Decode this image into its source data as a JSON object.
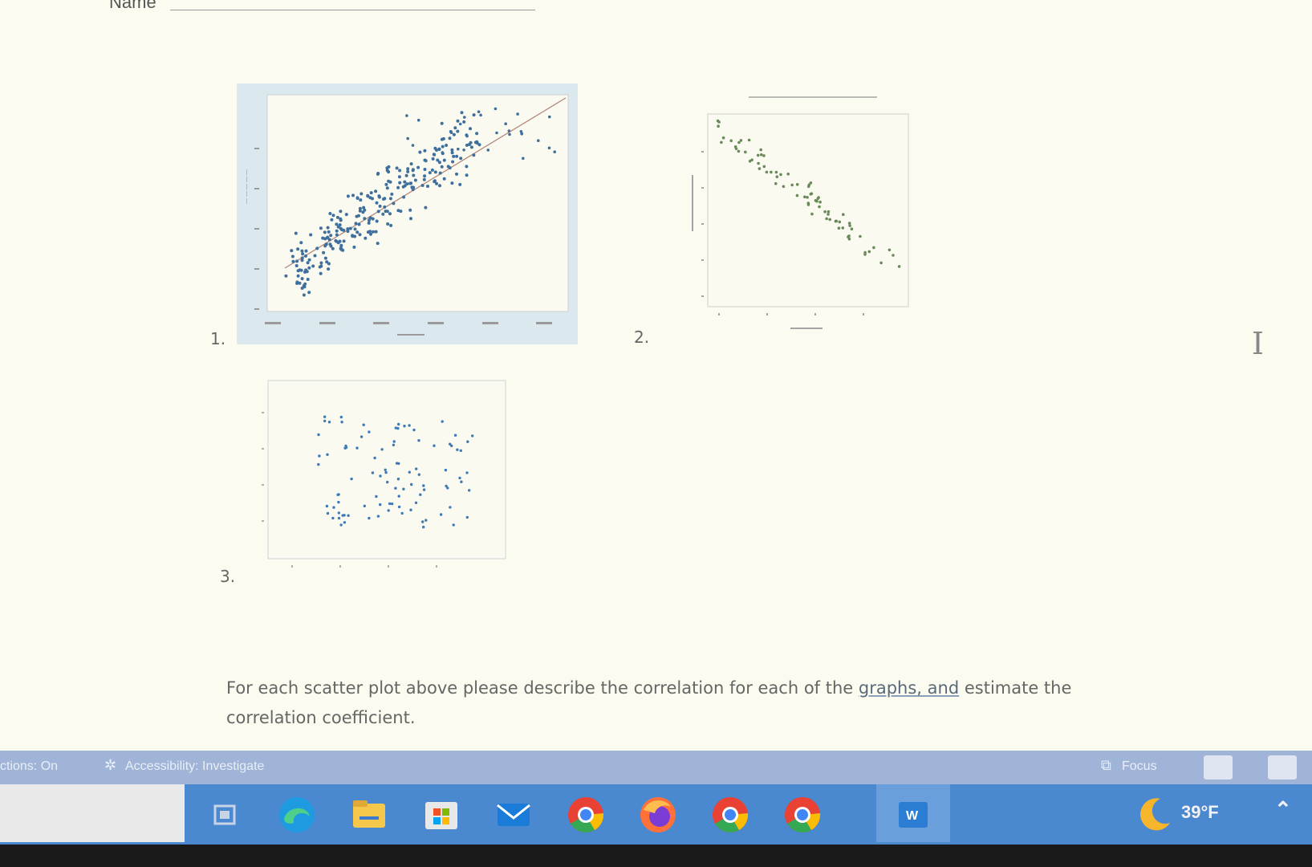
{
  "document": {
    "name_label": "Name",
    "questions": [
      {
        "number": "1."
      },
      {
        "number": "2."
      },
      {
        "number": "3."
      }
    ],
    "instruction_before_link": "For each scatter plot above please describe the correlation for each of the ",
    "instruction_link": "graphs, and",
    "instruction_after_link": " estimate the correlation coefficient.",
    "text_cursor_glyph": "I"
  },
  "status_bar": {
    "suggestions": "ctions: On",
    "accessibility": "Accessibility: Investigate",
    "focus": "Focus"
  },
  "taskbar": {
    "apps": [
      "task-view",
      "edge",
      "file-explorer",
      "microsoft-store",
      "mail",
      "chrome",
      "firefox",
      "chrome-profile-1",
      "chrome-profile-2",
      "word"
    ],
    "temperature": "39°F"
  },
  "colors": {
    "page": "#fbfbef",
    "taskbar": "#4a88d0",
    "status_bar": "#9fb4d7",
    "plot_blue": "#3f6f9c",
    "plot_green": "#6a8a5a"
  }
}
